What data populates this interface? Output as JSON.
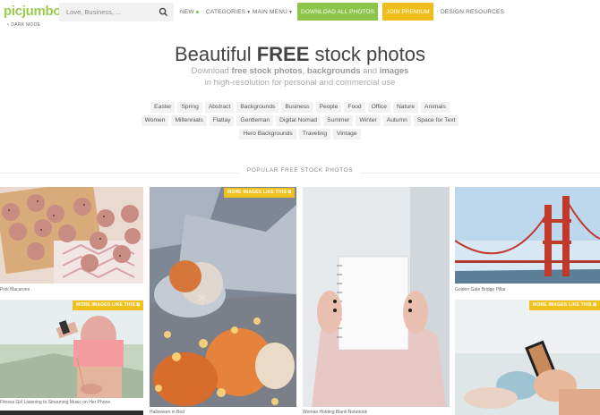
{
  "header": {
    "logo": "picjumbo",
    "search_placeholder": "Love, Business, ...",
    "nav": {
      "new": "NEW",
      "categories": "CATEGORIES",
      "main_menu": "MAIN MENU",
      "design_resources": "DESIGN RESOURCES"
    },
    "download_all": "DOWNLOAD ALL PHOTOS",
    "join_premium": "JOIN PREMIUM",
    "dark_mode": "DARK MODE"
  },
  "hero": {
    "title_pre": "Beautiful ",
    "title_bold": "FREE",
    "title_post": " stock photos",
    "sub1_pre": "Download ",
    "sub1_b1": "free stock photos",
    "sub1_mid": ", ",
    "sub1_b2": "backgrounds",
    "sub1_and": " and ",
    "sub1_b3": "images",
    "sub2": "in high-resolution for personal and commercial use"
  },
  "tags": {
    "row1": [
      "Easter",
      "Spring",
      "Abstract",
      "Backgrounds",
      "Business",
      "People",
      "Food",
      "Office",
      "Nature",
      "Animals"
    ],
    "row2": [
      "Women",
      "Millennials",
      "Flatlay",
      "Gentleman",
      "Digital Nomad",
      "Summer",
      "Winter",
      "Autumn",
      "Space for Text"
    ],
    "row3": [
      "Hero Backgrounds",
      "Traveling",
      "Vintage"
    ]
  },
  "section_title": "POPULAR FREE STOCK PHOTOS",
  "more_label": "MORE IMAGES LIKE THIS",
  "photos": {
    "macarons": "Pink Macarons",
    "fitness": "Fitness Girl Listening to Streaming Music on Her Phone",
    "halloween": "Halloween in Bed",
    "notebook": "Woman Holding Blank Notebook",
    "bridge": "Golden Gate Bridge Pillar"
  },
  "colors": {
    "brand": "#9ccc4f",
    "green_button": "#8cc54a",
    "premium": "#f0be1a"
  }
}
